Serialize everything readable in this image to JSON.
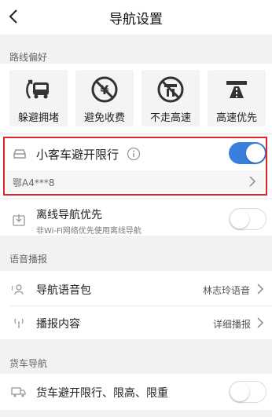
{
  "header": {
    "title": "导航设置"
  },
  "route_pref": {
    "label": "路线偏好",
    "tiles": [
      {
        "label": "躲避拥堵",
        "icon": "avoid-congestion-icon"
      },
      {
        "label": "避免收费",
        "icon": "no-toll-icon"
      },
      {
        "label": "不走高速",
        "icon": "no-highway-icon"
      },
      {
        "label": "高速优先",
        "icon": "highway-first-icon"
      }
    ]
  },
  "restriction": {
    "label": "小客车避开限行",
    "enabled": true,
    "plate": "鄂A4***8"
  },
  "offline": {
    "label": "离线导航优先",
    "sub": "非Wi-Fi网络优先使用离线导航",
    "enabled": false
  },
  "voice": {
    "label": "语音播报",
    "pack_label": "导航语音包",
    "pack_value": "林志玲语音",
    "content_label": "播报内容",
    "content_value": "详细播报"
  },
  "truck": {
    "label": "货车导航",
    "restrict_label": "货车避开限行、限高、限重",
    "enabled": false
  },
  "colors": {
    "accent": "#3a7fdc",
    "highlight": "#e0242e"
  }
}
